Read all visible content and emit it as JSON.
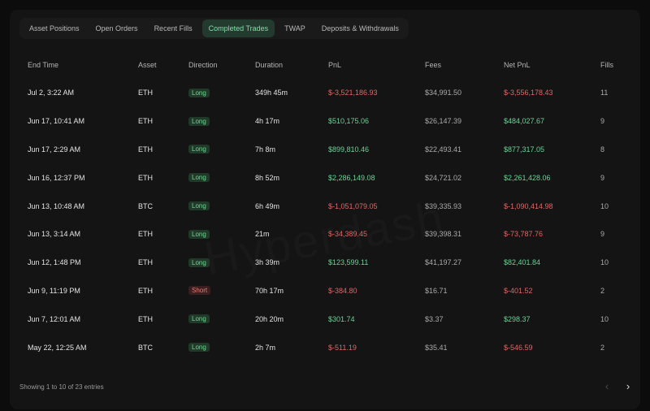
{
  "tabs": [
    {
      "label": "Asset Positions"
    },
    {
      "label": "Open Orders"
    },
    {
      "label": "Recent Fills"
    },
    {
      "label": "Completed Trades"
    },
    {
      "label": "TWAP"
    },
    {
      "label": "Deposits & Withdrawals"
    }
  ],
  "active_tab": "Completed Trades",
  "columns": [
    "End Time",
    "Asset",
    "Direction",
    "Duration",
    "PnL",
    "Fees",
    "Net PnL",
    "Fills"
  ],
  "rows": [
    {
      "end_time": "Jul 2, 3:22 AM",
      "asset": "ETH",
      "direction": "Long",
      "duration": "349h 45m",
      "pnl": "$-3,521,186.93",
      "fees": "$34,991.50",
      "net_pnl": "$-3,556,178.43",
      "fills": "11"
    },
    {
      "end_time": "Jun 17, 10:41 AM",
      "asset": "ETH",
      "direction": "Long",
      "duration": "4h 17m",
      "pnl": "$510,175.06",
      "fees": "$26,147.39",
      "net_pnl": "$484,027.67",
      "fills": "9"
    },
    {
      "end_time": "Jun 17, 2:29 AM",
      "asset": "ETH",
      "direction": "Long",
      "duration": "7h 8m",
      "pnl": "$899,810.46",
      "fees": "$22,493.41",
      "net_pnl": "$877,317.05",
      "fills": "8"
    },
    {
      "end_time": "Jun 16, 12:37 PM",
      "asset": "ETH",
      "direction": "Long",
      "duration": "8h 52m",
      "pnl": "$2,286,149.08",
      "fees": "$24,721.02",
      "net_pnl": "$2,261,428.06",
      "fills": "9"
    },
    {
      "end_time": "Jun 13, 10:48 AM",
      "asset": "BTC",
      "direction": "Long",
      "duration": "6h 49m",
      "pnl": "$-1,051,079.05",
      "fees": "$39,335.93",
      "net_pnl": "$-1,090,414.98",
      "fills": "10"
    },
    {
      "end_time": "Jun 13, 3:14 AM",
      "asset": "ETH",
      "direction": "Long",
      "duration": "21m",
      "pnl": "$-34,389.45",
      "fees": "$39,398.31",
      "net_pnl": "$-73,787.76",
      "fills": "9"
    },
    {
      "end_time": "Jun 12, 1:48 PM",
      "asset": "ETH",
      "direction": "Long",
      "duration": "3h 39m",
      "pnl": "$123,599.11",
      "fees": "$41,197.27",
      "net_pnl": "$82,401.84",
      "fills": "10"
    },
    {
      "end_time": "Jun 9, 11:19 PM",
      "asset": "ETH",
      "direction": "Short",
      "duration": "70h 17m",
      "pnl": "$-384.80",
      "fees": "$16.71",
      "net_pnl": "$-401.52",
      "fills": "2"
    },
    {
      "end_time": "Jun 7, 12:01 AM",
      "asset": "ETH",
      "direction": "Long",
      "duration": "20h 20m",
      "pnl": "$301.74",
      "fees": "$3.37",
      "net_pnl": "$298.37",
      "fills": "10"
    },
    {
      "end_time": "May 22, 12:25 AM",
      "asset": "BTC",
      "direction": "Long",
      "duration": "2h 7m",
      "pnl": "$-511.19",
      "fees": "$35.41",
      "net_pnl": "$-546.59",
      "fills": "2"
    }
  ],
  "footer": {
    "entries_text": "Showing 1 to 10 of 23 entries"
  },
  "pagination": {
    "prev_icon": "chevron-left-icon",
    "next_icon": "chevron-right-icon"
  },
  "colors": {
    "positive": "#6fcf97",
    "negative": "#e06666",
    "accent": "#7fe0a8"
  }
}
